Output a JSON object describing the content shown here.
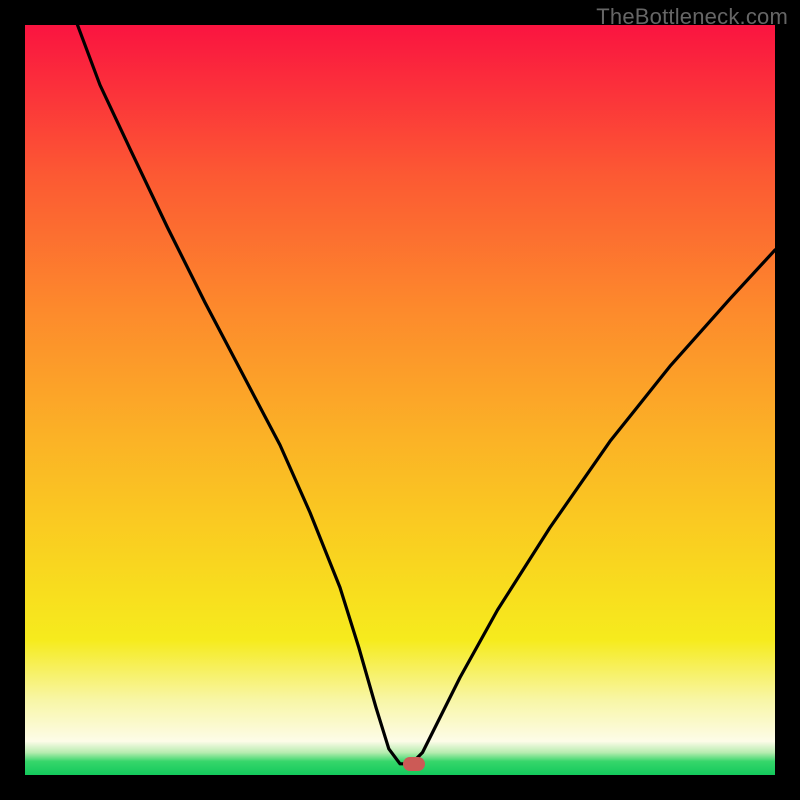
{
  "watermark": "TheBottleneck.com",
  "colors": {
    "frame_bg": "#000000",
    "watermark_text": "#666666",
    "curve_stroke": "#000000",
    "marker_fill": "#cc5a56",
    "gradient_stops": [
      {
        "pos": 0.0,
        "color": "#fa1440"
      },
      {
        "pos": 0.08,
        "color": "#fb2f3b"
      },
      {
        "pos": 0.2,
        "color": "#fc5933"
      },
      {
        "pos": 0.38,
        "color": "#fd8a2c"
      },
      {
        "pos": 0.55,
        "color": "#fbb226"
      },
      {
        "pos": 0.72,
        "color": "#f9d61f"
      },
      {
        "pos": 0.82,
        "color": "#f6eb1d"
      },
      {
        "pos": 0.9,
        "color": "#f8f6a6"
      },
      {
        "pos": 0.955,
        "color": "#fdfce8"
      },
      {
        "pos": 0.97,
        "color": "#b7ecb0"
      },
      {
        "pos": 0.982,
        "color": "#36d66a"
      },
      {
        "pos": 1.0,
        "color": "#13c95c"
      }
    ]
  },
  "chart_data": {
    "type": "line",
    "title": "",
    "xlabel": "",
    "ylabel": "",
    "xlim": [
      0,
      100
    ],
    "ylim": [
      0,
      100
    ],
    "note": "x and y are normalized 0–100 of the visible plot area; y=100 is top, y=0 is bottom. The background color encodes the same metric as y (red=high bottleneck, green=none). The marker sits at the minimum.",
    "series": [
      {
        "name": "bottleneck-curve",
        "x": [
          7,
          10,
          14,
          19,
          24,
          29,
          34,
          38,
          42,
          44.5,
          46.8,
          48.5,
          50,
          51.5,
          53,
          55,
          58,
          63,
          70,
          78,
          86,
          94,
          100
        ],
        "y": [
          100,
          92,
          83.5,
          73,
          63,
          53.5,
          44,
          35,
          25,
          17,
          9,
          3.5,
          1.5,
          1.5,
          3,
          7,
          13,
          22,
          33,
          44.5,
          54.5,
          63.5,
          70
        ]
      }
    ],
    "flat_segment": {
      "x_start": 48.5,
      "x_end": 52.5,
      "y": 1.5
    },
    "marker": {
      "x": 51.8,
      "y": 1.5
    }
  }
}
